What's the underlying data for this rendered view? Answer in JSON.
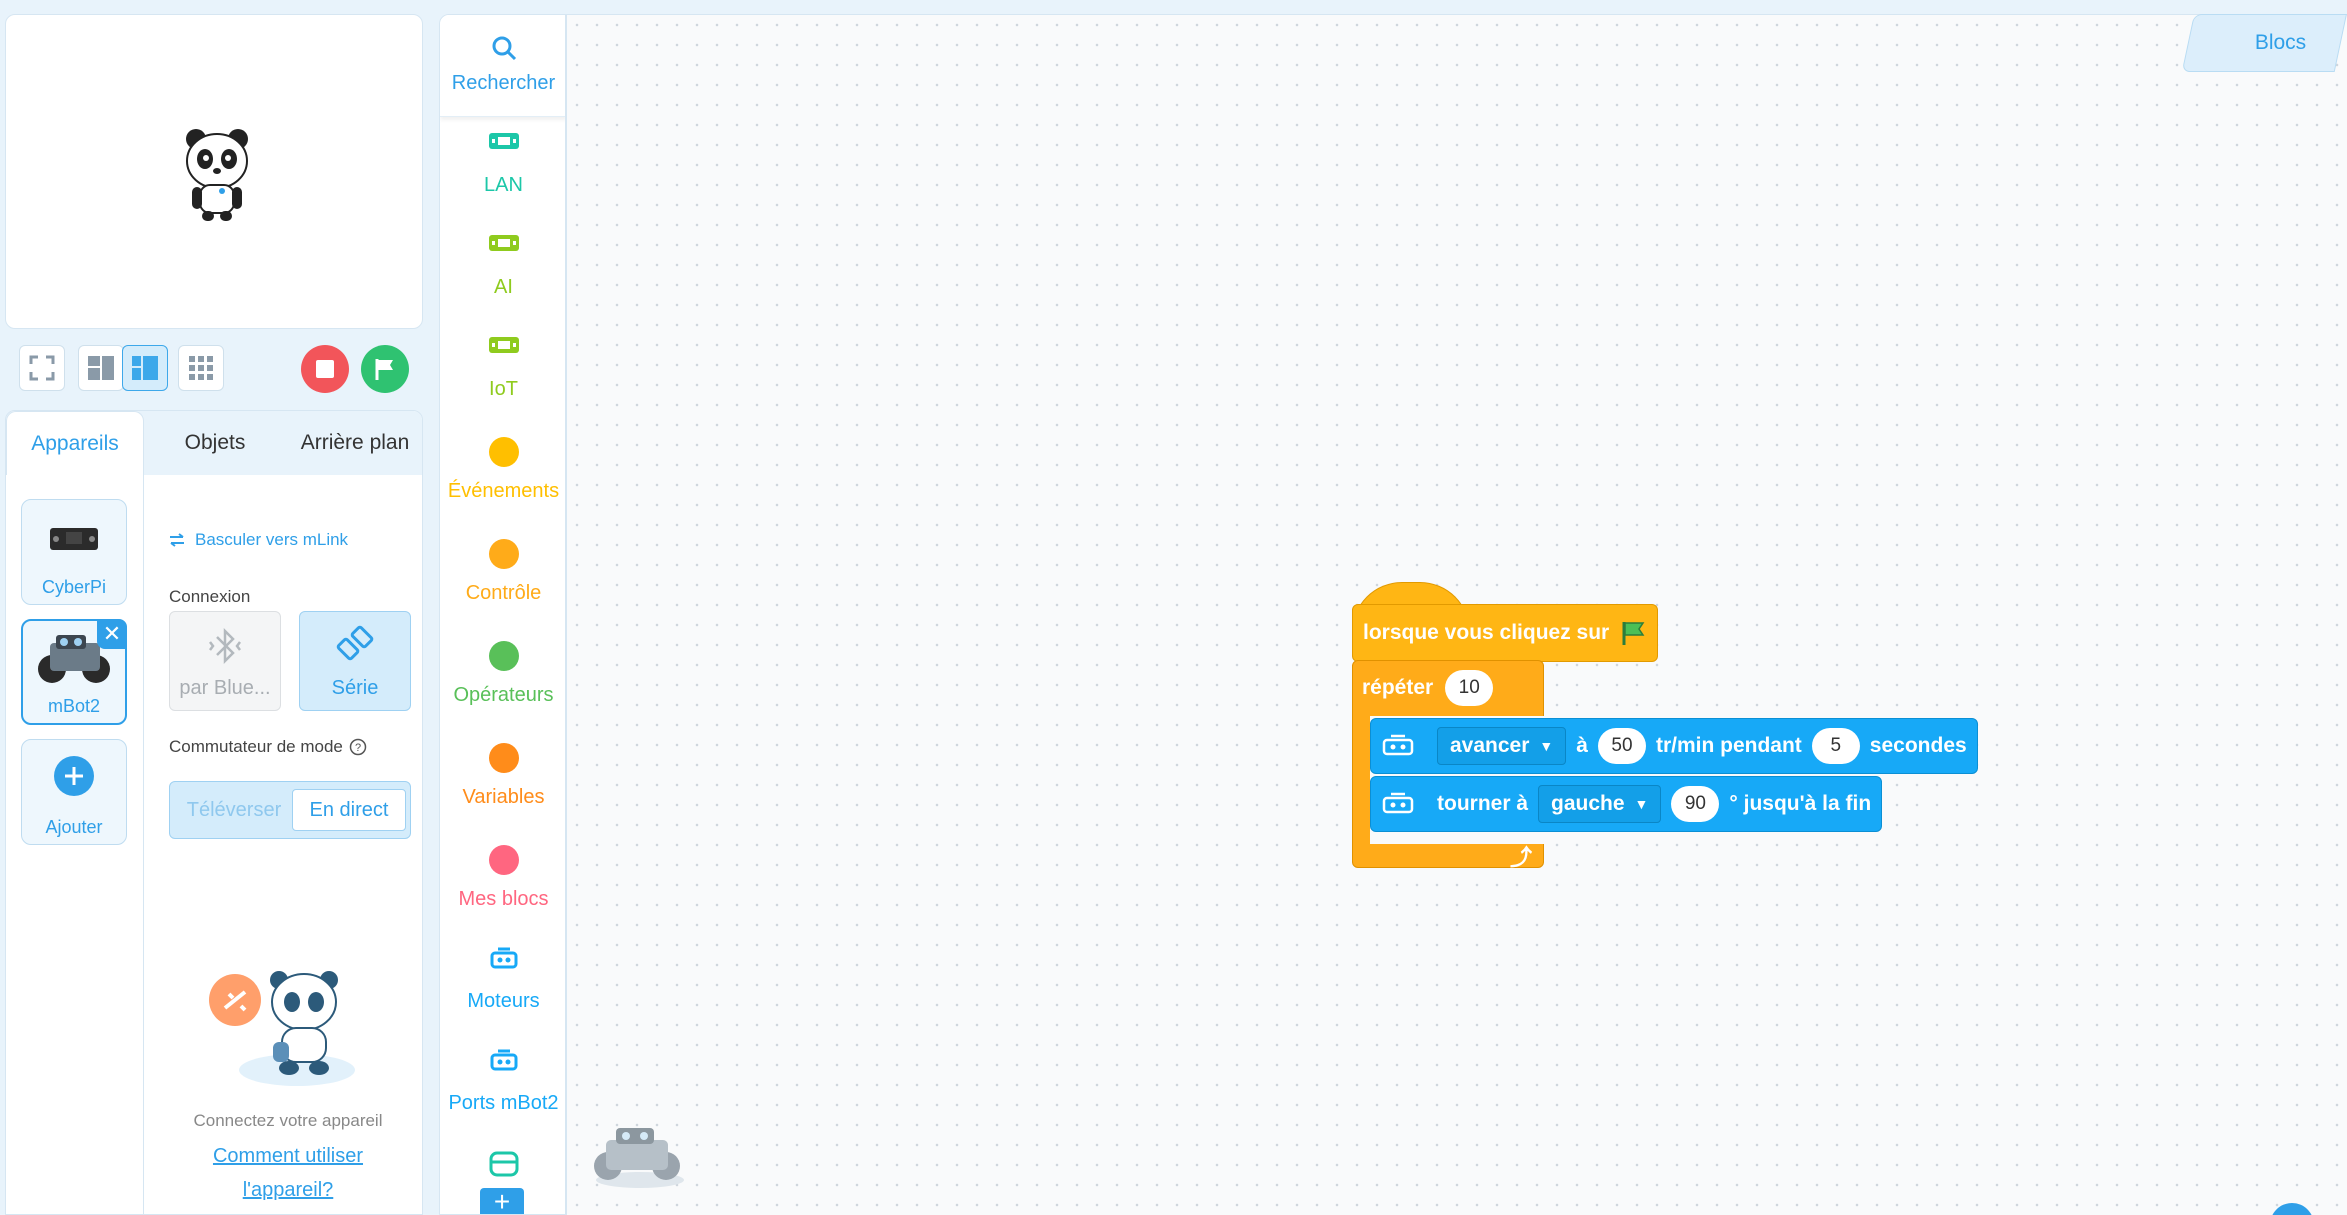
{
  "stage": {
    "sprite": "panda-sprite"
  },
  "stage_tools": {
    "fullscreen": "fullscreen-icon",
    "layouts": [
      "layout-small-icon",
      "layout-large-icon",
      "layout-grid-icon"
    ],
    "stop": "stop-icon",
    "go": "green-flag-icon"
  },
  "device_panel": {
    "tabs": [
      {
        "label": "Appareils",
        "active": true
      },
      {
        "label": "Objets",
        "active": false
      },
      {
        "label": "Arrière plan",
        "active": false
      }
    ],
    "devices": [
      {
        "label": "CyberPi",
        "selected": false
      },
      {
        "label": "mBot2",
        "selected": true
      },
      {
        "label": "Ajouter",
        "selected": false
      }
    ],
    "switch_link": "Basculer vers mLink",
    "connection_title": "Connexion",
    "connection_options": [
      {
        "label": "par Blue...",
        "enabled": false
      },
      {
        "label": "Série",
        "enabled": true
      }
    ],
    "mode_title": "Commutateur de mode",
    "modes": [
      {
        "label": "Téléverser",
        "active": false
      },
      {
        "label": "En direct",
        "active": true
      }
    ],
    "connect_message": "Connectez votre appareil",
    "howto_line1": "Comment utiliser",
    "howto_line2": "l'appareil?"
  },
  "palette": {
    "categories": [
      {
        "name": "Rechercher",
        "color": "#2f9fe8",
        "icon": "search-icon"
      },
      {
        "name": "LAN",
        "color": "#1cc7a8",
        "icon": "ext-lan-icon"
      },
      {
        "name": "AI",
        "color": "#8fcb1e",
        "icon": "ext-ai-icon"
      },
      {
        "name": "IoT",
        "color": "#8fcb1e",
        "icon": "ext-iot-icon"
      },
      {
        "name": "Événements",
        "color": "#ffbf00",
        "icon": "dot-icon"
      },
      {
        "name": "Contrôle",
        "color": "#ffab19",
        "icon": "dot-icon"
      },
      {
        "name": "Opérateurs",
        "color": "#59c059",
        "icon": "dot-icon"
      },
      {
        "name": "Variables",
        "color": "#ff8c1a",
        "icon": "dot-icon"
      },
      {
        "name": "Mes blocs",
        "color": "#ff6680",
        "icon": "dot-icon"
      },
      {
        "name": "Moteurs",
        "color": "#17a9f7",
        "icon": "robot-icon"
      },
      {
        "name": "Ports mBot2",
        "color": "#17a9f7",
        "icon": "robot-icon"
      }
    ],
    "add_extension": "+"
  },
  "workspace": {
    "tab_label": "Blocs",
    "hat_label": "lorsque vous cliquez sur",
    "repeat_label": "répéter",
    "repeat_count": "10",
    "move": {
      "direction": "avancer",
      "at": "à",
      "speed": "50",
      "unit": "tr/min pendant",
      "duration": "5",
      "seconds": "secondes"
    },
    "turn": {
      "label": "tourner à",
      "direction": "gauche",
      "angle": "90",
      "suffix": "° jusqu'à la fin"
    }
  }
}
